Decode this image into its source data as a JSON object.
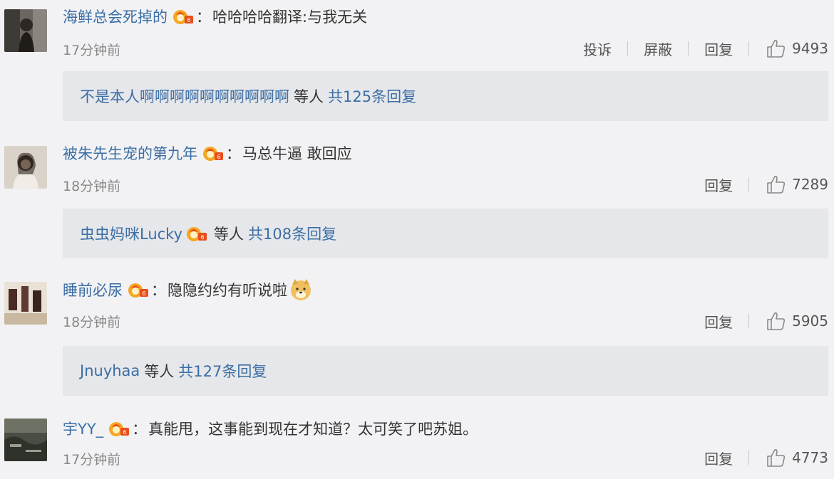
{
  "comments": [
    {
      "username": "海鲜总会死掉的",
      "colon": "：",
      "text": "哈哈哈哈翻译:与我无关",
      "time": "17分钟前",
      "actions": [
        "投诉",
        "屏蔽",
        "回复"
      ],
      "likes": "9493",
      "replies": {
        "names": "不是本人啊啊啊啊啊啊啊啊啊啊",
        "mid": "等人",
        "link": "共125条回复"
      }
    },
    {
      "username": "被朱先生宠的第九年",
      "colon": "：",
      "text": "马总牛逼 敢回应",
      "time": "18分钟前",
      "actions": [
        "回复"
      ],
      "likes": "7289",
      "replies": {
        "names": "虫虫妈咪Lucky",
        "mid": "等人",
        "link": "共108条回复"
      }
    },
    {
      "username": "睡前必尿",
      "colon": "：",
      "text": "隐隐约约有听说啦",
      "time": "18分钟前",
      "actions": [
        "回复"
      ],
      "likes": "5905",
      "replies": {
        "names": "Jnuyhaa",
        "mid": "等人",
        "link": "共127条回复"
      }
    },
    {
      "username": "宇YY_",
      "colon": "：",
      "text": "真能甩，这事能到现在才知道？太可笑了吧苏姐。",
      "time": "17分钟前",
      "actions": [
        "回复"
      ],
      "likes": "4773"
    }
  ],
  "icons": {
    "badge": "vip-badge-icon",
    "like": "thumbs-up-icon",
    "emoji": "doge-emoji-icon"
  },
  "colors": {
    "link": "#3b6ea5",
    "background": "#f2f2f4",
    "reply_box": "#e6e7ea",
    "muted": "#888888"
  }
}
